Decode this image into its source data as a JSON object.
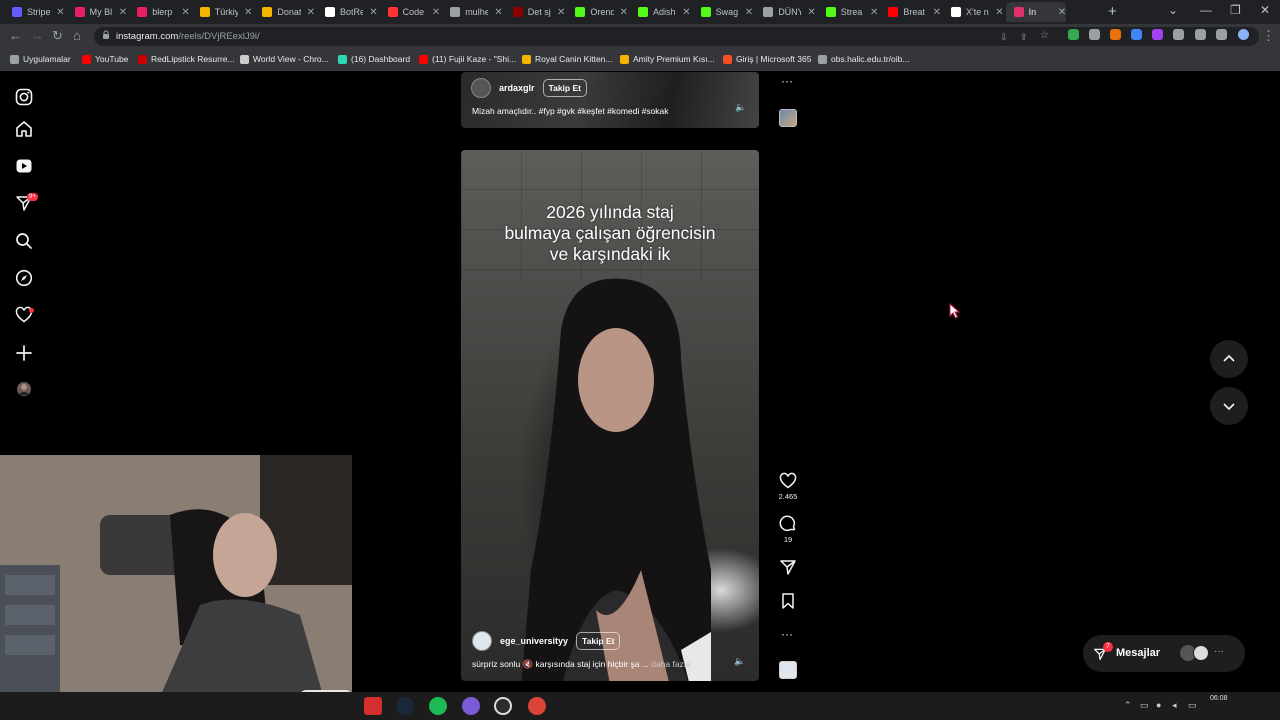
{
  "browser": {
    "tabs": [
      {
        "label": "Stripe",
        "color": "#635bff"
      },
      {
        "label": "My Bl",
        "color": "#e91e63"
      },
      {
        "label": "blerp",
        "color": "#e91e63"
      },
      {
        "label": "Türkiy",
        "color": "#f4b400"
      },
      {
        "label": "Donat",
        "color": "#f4b400"
      },
      {
        "label": "BotRe",
        "color": "#ffffff"
      },
      {
        "label": "Code",
        "color": "#ff3333"
      },
      {
        "label": "mulhe",
        "color": "#9aa0a6"
      },
      {
        "label": "Det sj",
        "color": "#8b0000"
      },
      {
        "label": "Orend",
        "color": "#53fc18"
      },
      {
        "label": "Adish",
        "color": "#53fc18"
      },
      {
        "label": "Swag",
        "color": "#53fc18"
      },
      {
        "label": "DÜNY",
        "color": "#9aa0a6"
      },
      {
        "label": "Strea",
        "color": "#53fc18"
      },
      {
        "label": "Breat",
        "color": "#ff0000"
      },
      {
        "label": "X'te n",
        "color": "#ffffff"
      },
      {
        "label": "In",
        "color": "#e1306c"
      }
    ],
    "url_host": "instagram.com",
    "url_path": "/reels/DVjREexlJ9i/",
    "bookmarks": [
      {
        "label": "Uygulamalar",
        "color": "#9aa0a6"
      },
      {
        "label": "YouTube",
        "color": "#ff0000"
      },
      {
        "label": "RedLipstick Resurre...",
        "color": "#cc0000"
      },
      {
        "label": "World View - Chro...",
        "color": "#cccccc"
      },
      {
        "label": "(16) Dashboard",
        "color": "#2fd6b5"
      },
      {
        "label": "(11) Fujii Kaze - \"Shi...",
        "color": "#ff0000"
      },
      {
        "label": "Royal Canin Kitten...",
        "color": "#f4b400"
      },
      {
        "label": "Amity Premium Kısı...",
        "color": "#f4b400"
      },
      {
        "label": "Giriş | Microsoft 365",
        "color": "#f25022"
      },
      {
        "label": "obs.halic.edu.tr/oib...",
        "color": "#9aa0a6"
      }
    ]
  },
  "sidebar": {
    "notification_badge": "9+"
  },
  "reels": [
    {
      "username": "ardaxglr",
      "follow_label": "Takip Et",
      "caption": "Mizah amaçlıdır.. #fyp #gvk #keşfet #komedi #sokak"
    },
    {
      "overlay_lines": [
        "2026 yılında staj",
        "bulmaya çalışan öğrencisin",
        "ve karşındaki ik"
      ],
      "username": "ege_universityy",
      "follow_label": "Takip Et",
      "caption": "sürpriz sonlu 🔇 karşısında staj için hiçbir şa ...",
      "more_label": "daha fazla",
      "likes": "2.465",
      "comments": "19"
    }
  ],
  "messages": {
    "label": "Mesajlar",
    "badge": "7"
  },
  "taskbar": {
    "time": "06:08"
  }
}
